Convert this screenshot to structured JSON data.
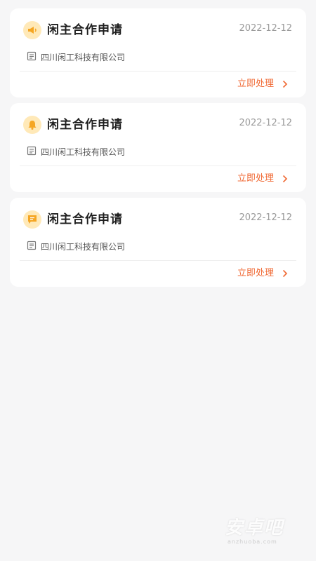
{
  "notifications": [
    {
      "icon": "megaphone-icon",
      "title": "闲主合作申请",
      "date": "2022-12-12",
      "company": "四川闲工科技有限公司",
      "action_label": "立即处理"
    },
    {
      "icon": "bell-icon",
      "title": "闲主合作申请",
      "date": "2022-12-12",
      "company": "四川闲工科技有限公司",
      "action_label": "立即处理"
    },
    {
      "icon": "message-icon",
      "title": "闲主合作申请",
      "date": "2022-12-12",
      "company": "四川闲工科技有限公司",
      "action_label": "立即处理"
    }
  ],
  "watermark": {
    "text": "安卓吧",
    "subtext": "anzhuoba.com"
  },
  "colors": {
    "accent": "#f06a35",
    "icon_bg": "#ffe9b8",
    "icon_fg": "#f5a623",
    "background": "#f6f6f7"
  }
}
